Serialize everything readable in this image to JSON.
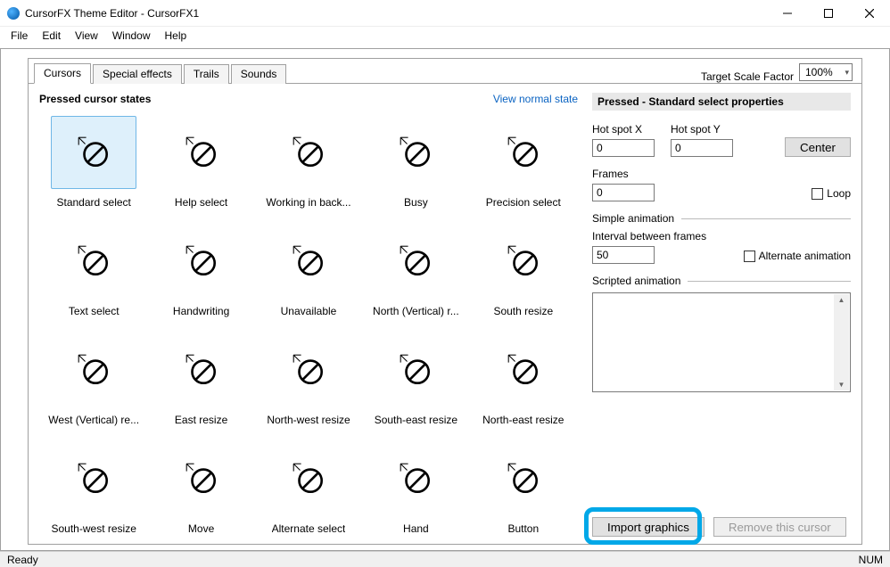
{
  "window": {
    "title": "CursorFX Theme Editor - CursorFX1",
    "controls": {
      "min": "—",
      "max": "☐",
      "close": "✕"
    }
  },
  "menu": [
    "File",
    "Edit",
    "View",
    "Window",
    "Help"
  ],
  "tabs": [
    "Cursors",
    "Special effects",
    "Trails",
    "Sounds"
  ],
  "scale": {
    "label": "Target Scale Factor",
    "value": "100%"
  },
  "left": {
    "title": "Pressed cursor states",
    "link": "View normal state",
    "cursors": [
      "Standard select",
      "Help select",
      "Working in back...",
      "Busy",
      "Precision select",
      "Text select",
      "Handwriting",
      "Unavailable",
      "North (Vertical) r...",
      "South resize",
      "West (Vertical) re...",
      "East resize",
      "North-west resize",
      "South-east resize",
      "North-east resize",
      "South-west resize",
      "Move",
      "Alternate select",
      "Hand",
      "Button"
    ],
    "selectedIndex": 0
  },
  "right": {
    "title": "Pressed - Standard select properties",
    "hotspot_x_label": "Hot spot X",
    "hotspot_x": "0",
    "hotspot_y_label": "Hot spot Y",
    "hotspot_y": "0",
    "center_btn": "Center",
    "frames_label": "Frames",
    "frames": "0",
    "loop_label": "Loop",
    "simple_anim_label": "Simple animation",
    "interval_label": "Interval between frames",
    "interval": "50",
    "alt_anim_label": "Alternate animation",
    "scripted_label": "Scripted animation",
    "import_btn": "Import graphics",
    "remove_btn": "Remove this cursor"
  },
  "status": {
    "ready": "Ready",
    "num": "NUM"
  }
}
